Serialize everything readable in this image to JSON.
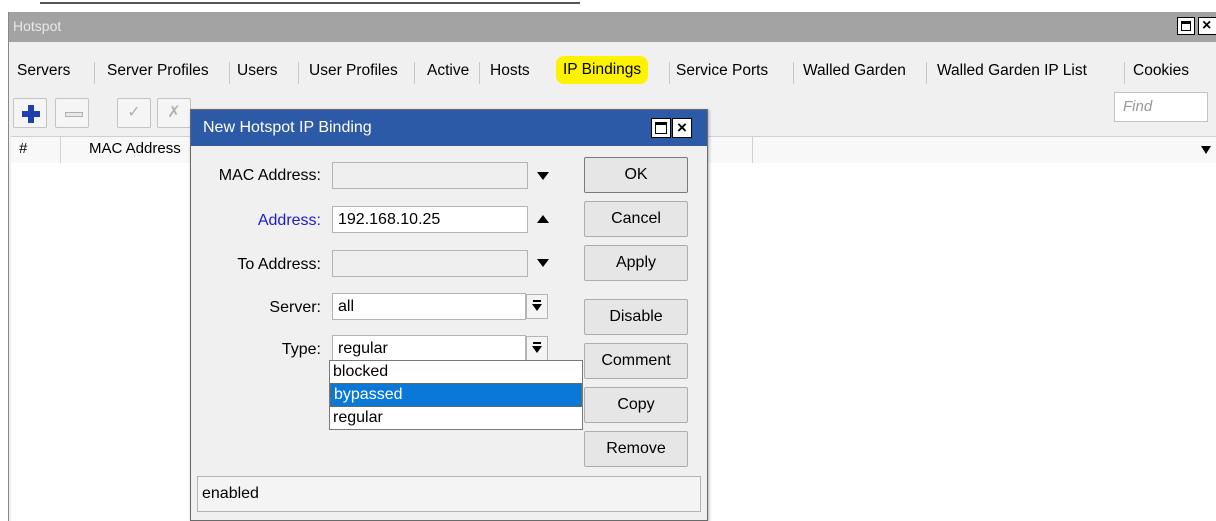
{
  "window": {
    "title": "Hotspot"
  },
  "tabs": [
    {
      "label": "Servers"
    },
    {
      "label": "Server Profiles"
    },
    {
      "label": "Users"
    },
    {
      "label": "User Profiles"
    },
    {
      "label": "Active"
    },
    {
      "label": "Hosts"
    },
    {
      "label": "IP Bindings",
      "active": true
    },
    {
      "label": "Service Ports"
    },
    {
      "label": "Walled Garden"
    },
    {
      "label": "Walled Garden IP List"
    },
    {
      "label": "Cookies"
    }
  ],
  "toolbar": {
    "buttons": [
      "add-icon",
      "remove-icon",
      "enable-icon",
      "disable-icon",
      "comment-icon",
      "filter-icon"
    ],
    "find_placeholder": "Find"
  },
  "list": {
    "columns": [
      "#",
      "MAC Address"
    ]
  },
  "dialog": {
    "title": "New Hotspot IP Binding",
    "fields": {
      "mac_label": "MAC Address:",
      "mac_value": "",
      "address_label": "Address:",
      "address_value": "192.168.10.25",
      "to_address_label": "To Address:",
      "to_address_value": "",
      "server_label": "Server:",
      "server_value": "all",
      "type_label": "Type:",
      "type_value": "regular"
    },
    "type_options": [
      "blocked",
      "bypassed",
      "regular"
    ],
    "type_highlighted": "bypassed",
    "buttons": {
      "ok": "OK",
      "cancel": "Cancel",
      "apply": "Apply",
      "disable": "Disable",
      "comment": "Comment",
      "copy": "Copy",
      "remove": "Remove"
    },
    "status": "enabled"
  },
  "colors": {
    "dialog_title_bg": "#2d5aa6",
    "highlight": "#fff200",
    "selection": "#0a78d7",
    "address_label": "#1d1bd0"
  }
}
